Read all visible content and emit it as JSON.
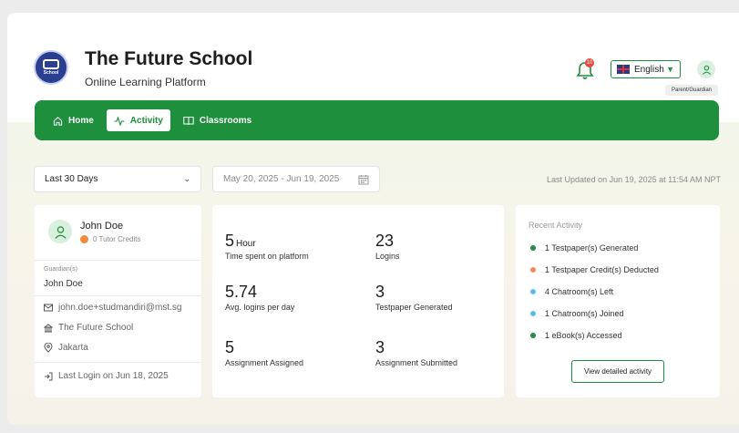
{
  "app": {
    "title": "The Future School",
    "subtitle": "Online Learning Platform",
    "logo_text": "School"
  },
  "header": {
    "notification_count": "10",
    "language": "English",
    "role": "Parent/Guardian"
  },
  "nav": {
    "items": [
      {
        "label": "Home",
        "icon": "home-icon",
        "active": false
      },
      {
        "label": "Activity",
        "icon": "activity-icon",
        "active": true
      },
      {
        "label": "Classrooms",
        "icon": "book-icon",
        "active": false
      }
    ]
  },
  "filters": {
    "period": "Last 30 Days",
    "date_range": "May 20, 2025 - Jun 19, 2025",
    "last_updated": "Last Updated on Jun 19, 2025 at 11:54 AM NPT"
  },
  "profile": {
    "name": "John Doe",
    "credits": "0 Tutor Credits",
    "guardian_label": "Guardian(s)",
    "guardian_name": "John Doe",
    "email": "john.doe+studmandiri@mst.sg",
    "school": "The Future School",
    "location": "Jakarta",
    "last_login": "Last Login on Jun 18, 2025"
  },
  "stats": [
    {
      "value": "5",
      "unit": "Hour",
      "label": "Time spent on platform"
    },
    {
      "value": "23",
      "unit": "",
      "label": "Logins"
    },
    {
      "value": "5.74",
      "unit": "",
      "label": "Avg. logins per day"
    },
    {
      "value": "3",
      "unit": "",
      "label": "Testpaper Generated"
    },
    {
      "value": "5",
      "unit": "",
      "label": "Assignment Assigned"
    },
    {
      "value": "3",
      "unit": "",
      "label": "Assignment Submitted"
    }
  ],
  "recent": {
    "title": "Recent Activity",
    "items": [
      {
        "text": "1 Testpaper(s) Generated",
        "color": "#1e8f3c"
      },
      {
        "text": "1 Testpaper Credit(s) Deducted",
        "color": "#f08a5c"
      },
      {
        "text": "4 Chatroom(s) Left",
        "color": "#5bbde8"
      },
      {
        "text": "1 Chatroom(s) Joined",
        "color": "#5bbde8"
      },
      {
        "text": "1 eBook(s) Accessed",
        "color": "#1e8f3c"
      }
    ],
    "button": "View detailed activity"
  },
  "colors": {
    "brand_green": "#1e8f3c",
    "logo_blue": "#2a3f8f"
  }
}
